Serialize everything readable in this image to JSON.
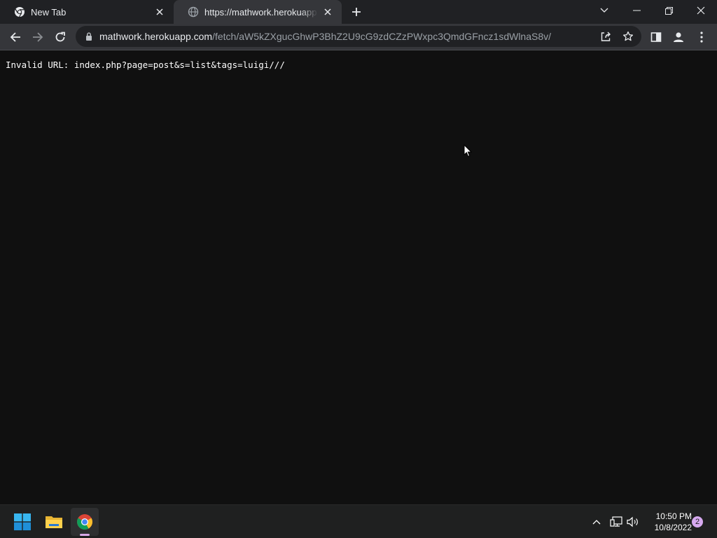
{
  "browser": {
    "tabs": [
      {
        "title": "New Tab",
        "active": false,
        "icon": "chrome-icon"
      },
      {
        "title": "https://mathwork.herokuapp.com",
        "active": true,
        "icon": "globe-icon"
      }
    ],
    "address_bar": {
      "host": "mathwork.herokuapp.com",
      "path": "/fetch/aW5kZXgucGhwP3BhZ2U9cG9zdCZzPWxpc3QmdGFncz1sdWlnaS8v/"
    }
  },
  "page": {
    "message": "Invalid URL: index.php?page=post&s=list&tags=luigi///"
  },
  "taskbar": {
    "apps": [
      "windows-start-icon",
      "file-explorer-icon",
      "chrome-icon"
    ],
    "clock": {
      "time": "10:50 PM",
      "date": "10/8/2022"
    },
    "notification_count": "2"
  },
  "colors": {
    "page_background": "#101010",
    "tabstrip": "#202124",
    "toolbar": "#35363a",
    "omnibox": "#202124",
    "badge": "#d6a9ef"
  }
}
